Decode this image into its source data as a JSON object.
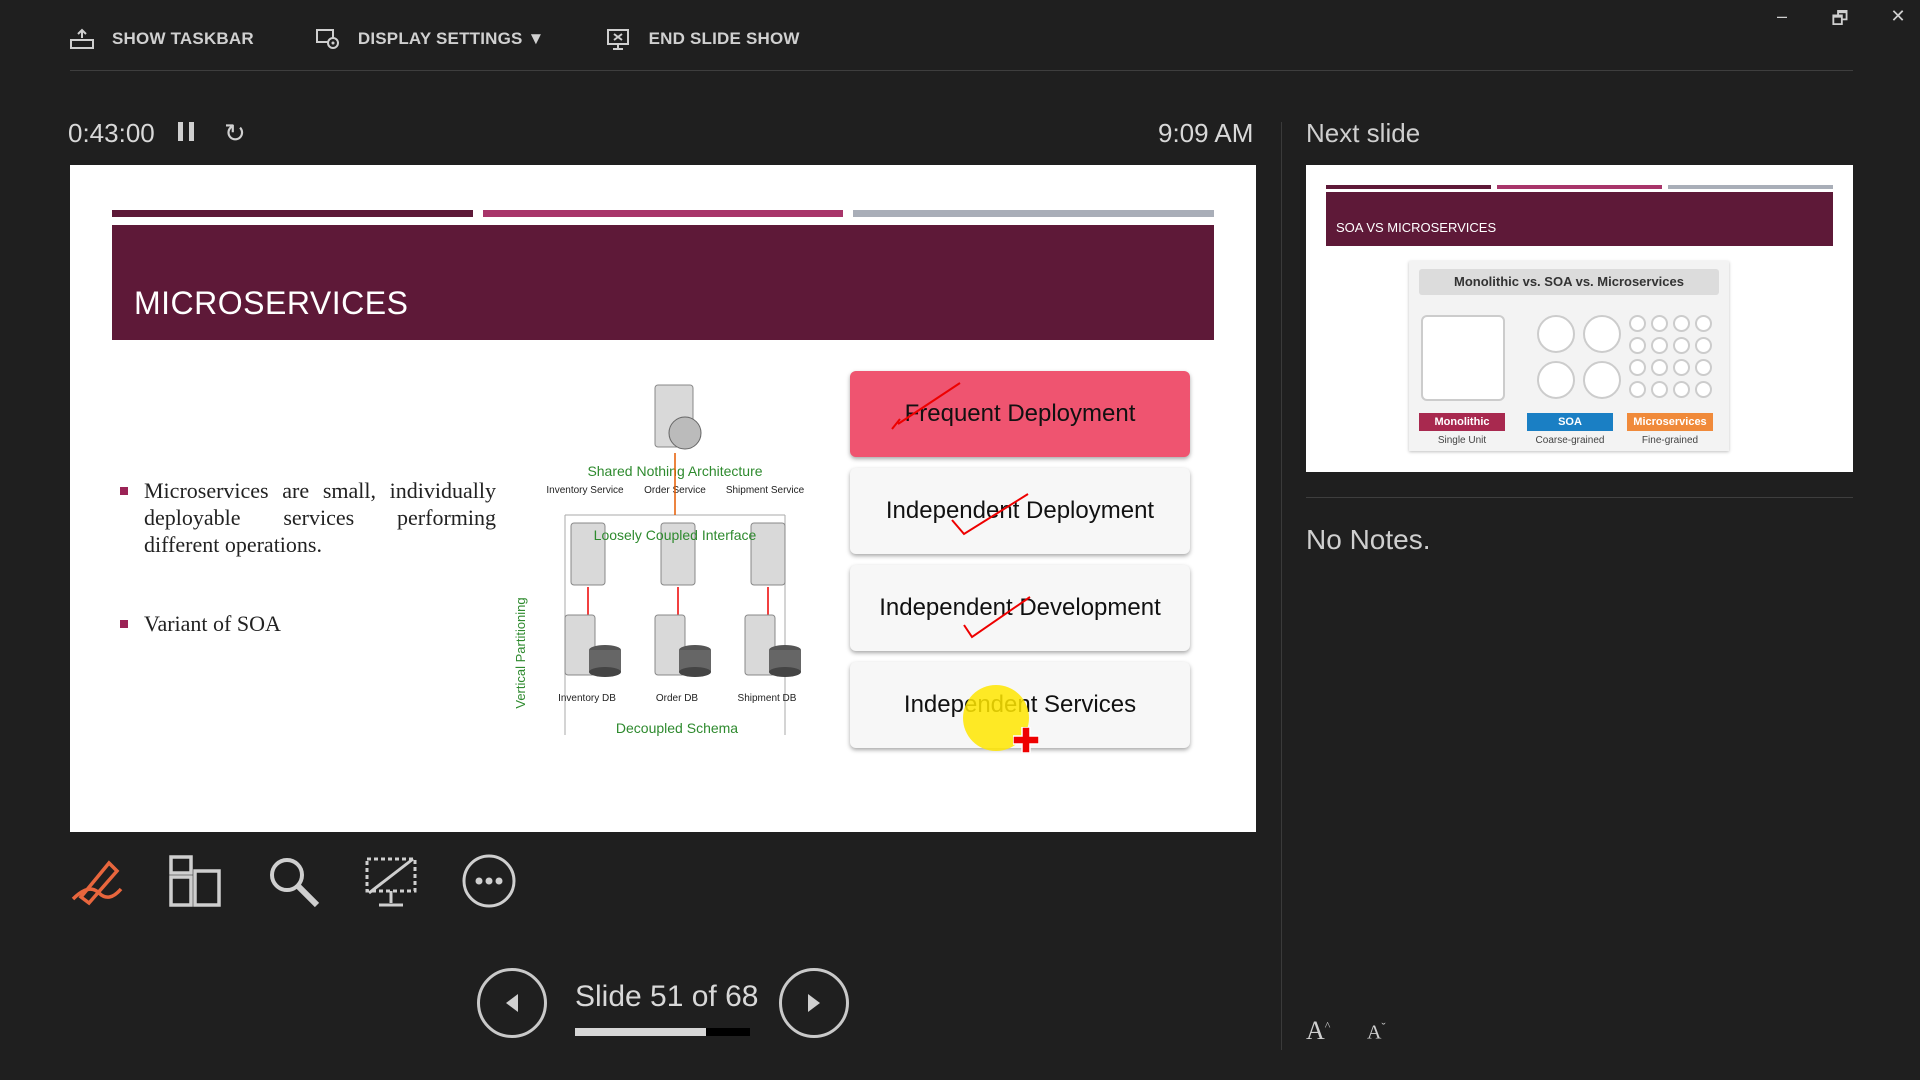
{
  "toolbar": {
    "show_taskbar": "SHOW TASKBAR",
    "display_settings": "DISPLAY SETTINGS ▼",
    "end_slide_show": "END SLIDE SHOW"
  },
  "window_controls": {
    "minimize": "–",
    "restore": "🗗",
    "close": "✕"
  },
  "timer": {
    "elapsed": "0:43:00",
    "clock": "9:09 AM",
    "reset_glyph": "↻"
  },
  "current_slide": {
    "title": "MICROSERVICES",
    "bar_colors": [
      "#5e1938",
      "#a8356a",
      "#a9aeb8"
    ],
    "band_color": "#5e1938",
    "bullets": [
      "Microservices are small, individually deployable services performing different operations.",
      "Variant of SOA"
    ],
    "diagram": {
      "top_label": "Shared Nothing Architecture",
      "services": [
        "Inventory Service",
        "Order Service",
        "Shipment Service"
      ],
      "interface_label": "Loosely Coupled Interface",
      "side_label": "Vertical Partitioning",
      "dbs": [
        "Inventory DB",
        "Order DB",
        "Shipment DB"
      ],
      "bottom_label": "Decoupled Schema"
    },
    "cards": [
      "Frequent Deployment",
      "Independent Deployment",
      "Independent Development",
      "Independent Services"
    ]
  },
  "tools": {
    "pen": "pen-tool",
    "all_slides": "see-all-slides",
    "zoom": "zoom-into-slide",
    "black_screen": "black-or-unblack-slide",
    "more": "more-options"
  },
  "navigation": {
    "slide_counter": "Slide 51 of 68",
    "progress_fraction": 0.75
  },
  "next_slide": {
    "label": "Next slide",
    "title": "SOA VS MICROSERVICES",
    "card_title": "Monolithic vs. SOA vs. Microservices",
    "columns": [
      {
        "badge": "Monolithic",
        "sub": "Single Unit",
        "color": "#a8294f"
      },
      {
        "badge": "SOA",
        "sub": "Coarse-grained",
        "color": "#1a7fc4"
      },
      {
        "badge": "Microservices",
        "sub": "Fine-grained",
        "color": "#f08a3a"
      }
    ]
  },
  "notes": {
    "text": "No Notes."
  },
  "font_controls": {
    "increase": "A",
    "decrease": "A"
  }
}
